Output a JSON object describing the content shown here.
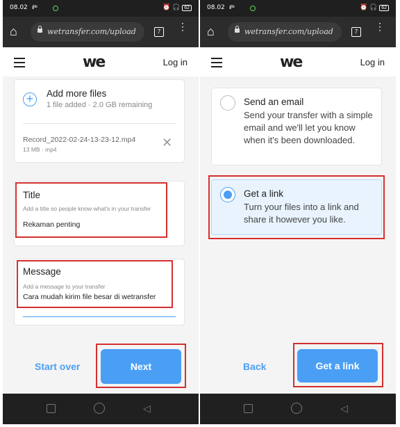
{
  "status": {
    "time": "08.02",
    "signal": "ıl ᵇᵏ",
    "battery": "62",
    "icons": "⏰ 🎧"
  },
  "browser": {
    "url": "wetransfer.com/upload",
    "tab_count": "7"
  },
  "appbar": {
    "logo": "we",
    "login": "Log in"
  },
  "left": {
    "add_files": {
      "title": "Add more files",
      "subtitle": "1 file added · 2.0 GB remaining"
    },
    "file": {
      "name": "Record_2022-02-24-13-23-12.mp4",
      "meta": "13 MB · mp4"
    },
    "title_field": {
      "label": "Title",
      "hint": "Add a title so people know what's in your transfer",
      "value": "Rekaman penting"
    },
    "message_field": {
      "label": "Message",
      "hint": "Add a message to your transfer",
      "value": "Cara mudah kirim file besar di wetransfer"
    },
    "start_over": "Start over",
    "next": "Next"
  },
  "right": {
    "email_option": {
      "title": "Send an email",
      "desc": "Send your transfer with a simple email and we'll let you know when it's been downloaded."
    },
    "link_option": {
      "title": "Get a link",
      "desc": "Turn your files into a link and share it however you like."
    },
    "back": "Back",
    "get_link": "Get a link"
  },
  "colors": {
    "accent": "#4a9ff5",
    "highlight": "#d32f2f",
    "selected_bg": "#e8f3fd"
  }
}
